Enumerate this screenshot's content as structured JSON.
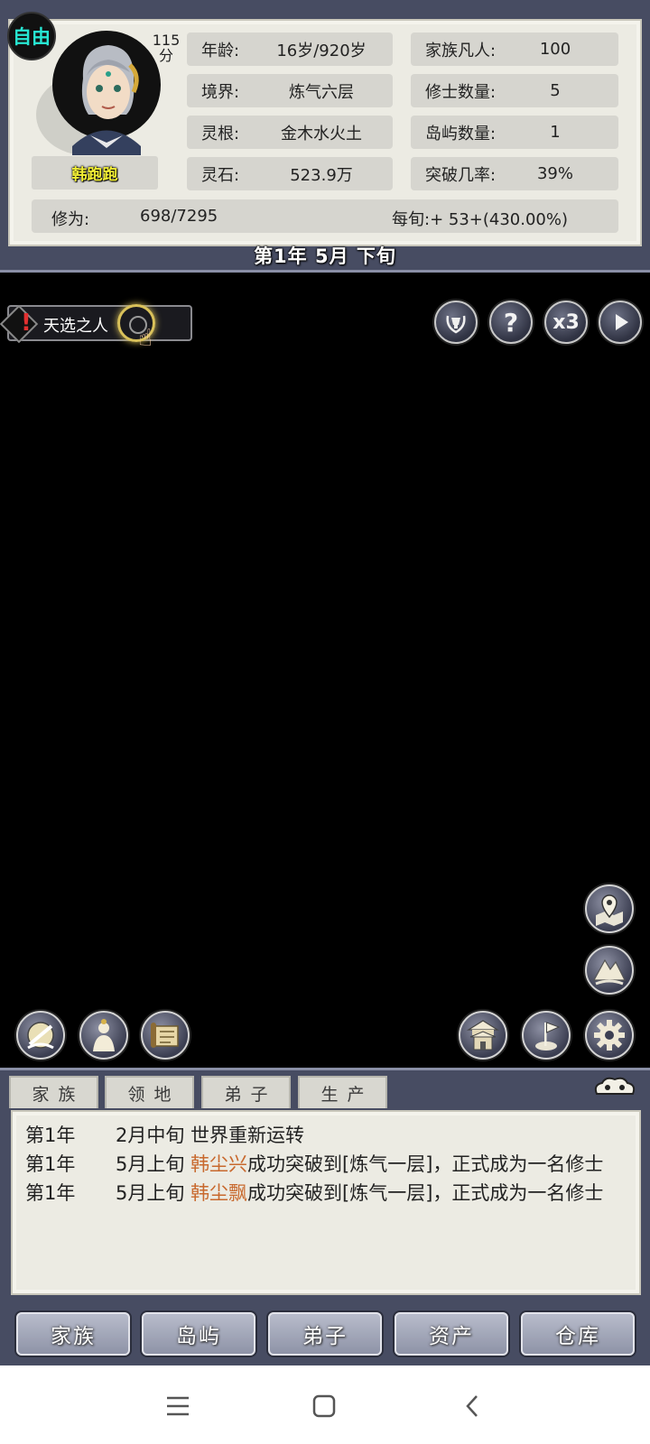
{
  "header": {
    "free_badge": "自由",
    "score": "115\n分",
    "name": "韩跑跑",
    "stats_left": [
      {
        "label": "年龄:",
        "value": "16岁/920岁"
      },
      {
        "label": "境界:",
        "value": "炼气六层"
      },
      {
        "label": "灵根:",
        "value": "金木水火土"
      },
      {
        "label": "灵石:",
        "value": "523.9万"
      }
    ],
    "stats_right": [
      {
        "label": "家族凡人:",
        "value": "100"
      },
      {
        "label": "修士数量:",
        "value": "5"
      },
      {
        "label": "岛屿数量:",
        "value": "1"
      },
      {
        "label": "突破几率:",
        "value": "39%"
      }
    ],
    "cultivation_label": "修为:",
    "cultivation_value": "698/7295",
    "per_turn": "每旬:+ 53+(430.00%)",
    "date": "第1年 5月 下旬"
  },
  "quest": {
    "label": "天选之人"
  },
  "controls": {
    "speed": "x3"
  },
  "log_tabs": [
    "家族",
    "领地",
    "弟子",
    "生产"
  ],
  "log": [
    {
      "year": "第1年",
      "pre": "2月中旬 世界重新运转",
      "name": "",
      "post": ""
    },
    {
      "year": "第1年",
      "pre": "5月上旬 ",
      "name": "韩尘兴",
      "post": "成功突破到[炼气一层]，正式成为一名修士"
    },
    {
      "year": "第1年",
      "pre": "5月上旬 ",
      "name": "韩尘飘",
      "post": "成功突破到[炼气一层]，正式成为一名修士"
    }
  ],
  "nav": [
    "家族",
    "岛屿",
    "弟子",
    "资产",
    "仓库"
  ],
  "colors": {
    "highlight": "#c8692e",
    "free_badge": "#27e6d2",
    "name": "#f2ee35",
    "frame": "#474c62"
  }
}
